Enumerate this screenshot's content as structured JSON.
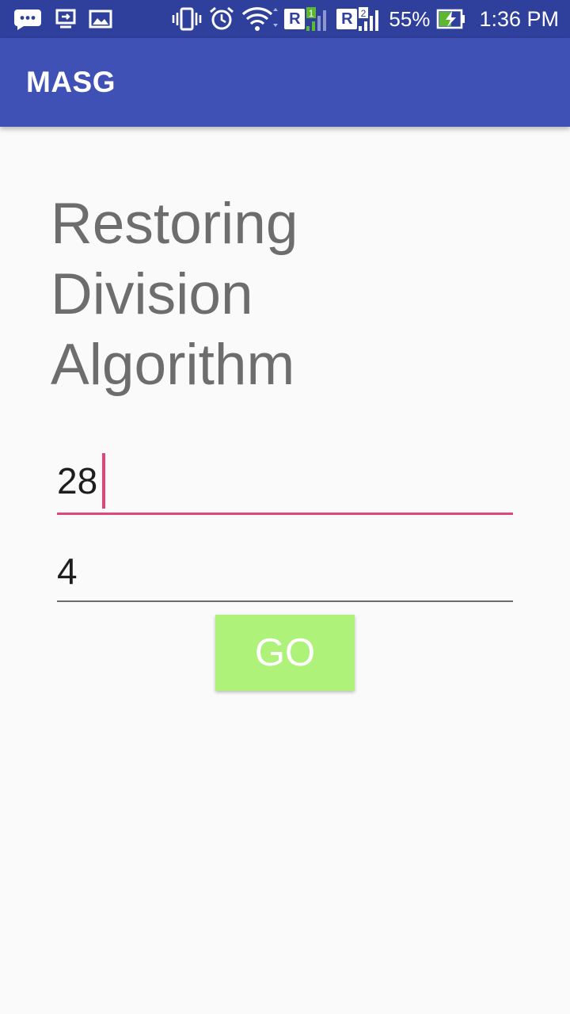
{
  "status_bar": {
    "battery": "55%",
    "time": "1:36 PM",
    "sim1_badge": "R",
    "sim2_badge": "R",
    "sim1_slot": "1",
    "sim2_slot": "2",
    "icons": [
      "chat-bubble-icon",
      "screen-cast-icon",
      "image-icon",
      "vibrate-icon",
      "alarm-icon",
      "wifi-icon",
      "signal-icon",
      "battery-charging-icon"
    ]
  },
  "app_bar": {
    "title": "MASG"
  },
  "main": {
    "heading_lines": [
      "Restoring",
      "Division",
      "Algorithm"
    ],
    "dividend_value": "28",
    "divisor_value": "4",
    "go_label": "GO"
  },
  "colors": {
    "status_bar": "#2f3f9c",
    "app_bar": "#3f51b5",
    "accent": "#e2457c",
    "go_button": "#aef27a",
    "background": "#fafafa"
  }
}
